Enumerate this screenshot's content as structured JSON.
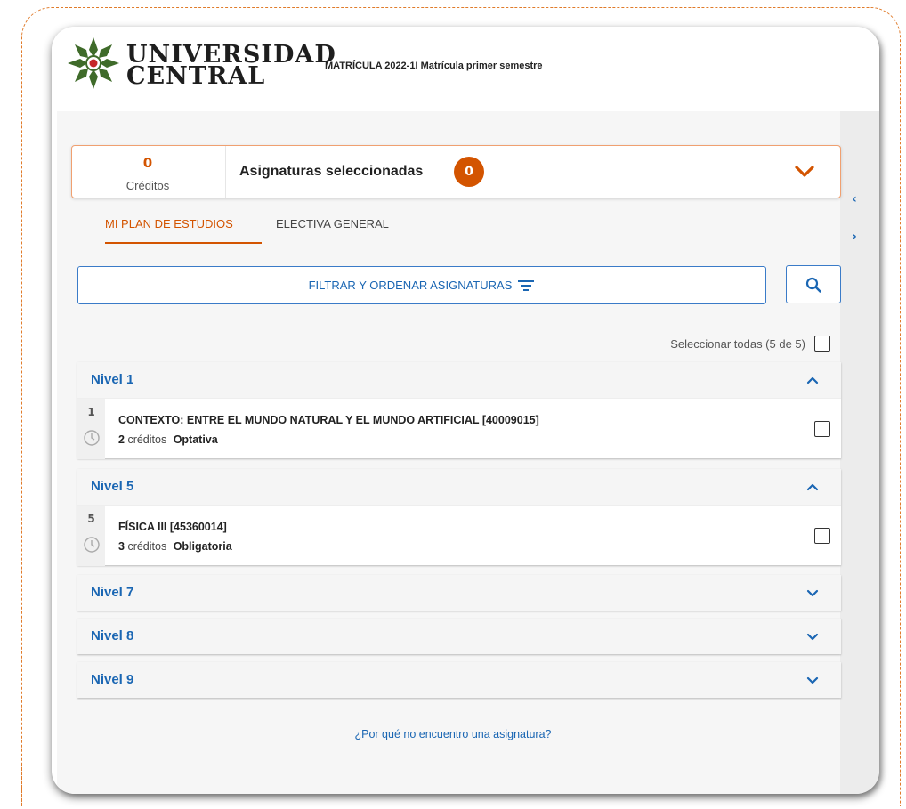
{
  "header": {
    "logo_line1": "UNIVERSIDAD",
    "logo_line2": "CENTRAL",
    "title": "MATRÍCULA 2022-1I Matrícula primer semestre"
  },
  "summary": {
    "credits_value": "0",
    "credits_label": "Créditos",
    "title": "Asignaturas seleccionadas",
    "selected_count": "0"
  },
  "tabs": [
    {
      "label": "MI PLAN DE ESTUDIOS",
      "active": true
    },
    {
      "label": "ELECTIVA GENERAL",
      "active": false
    }
  ],
  "filter": {
    "label": "FILTRAR Y ORDENAR ASIGNATURAS"
  },
  "select_all": {
    "label": "Seleccionar todas (5 de 5)"
  },
  "levels": [
    {
      "title": "Nivel 1",
      "expanded": true,
      "courses": [
        {
          "level": "1",
          "name": "CONTEXTO: ENTRE EL MUNDO NATURAL Y EL MUNDO ARTIFICIAL [40009015]",
          "credits": "2",
          "credits_unit": "créditos",
          "type": "Optativa"
        }
      ]
    },
    {
      "title": "Nivel 5",
      "expanded": true,
      "courses": [
        {
          "level": "5",
          "name": "FÍSICA III [45360014]",
          "credits": "3",
          "credits_unit": "créditos",
          "type": "Obligatoria"
        }
      ]
    },
    {
      "title": "Nivel 7",
      "expanded": false,
      "courses": []
    },
    {
      "title": "Nivel 8",
      "expanded": false,
      "courses": []
    },
    {
      "title": "Nivel 9",
      "expanded": false,
      "courses": []
    }
  ],
  "help": {
    "link_label": "¿Por qué no encuentro una asignatura?"
  },
  "colors": {
    "accent_orange": "#d35400",
    "link_blue": "#1a66b3",
    "frame_dashed": "#e07b2a"
  }
}
